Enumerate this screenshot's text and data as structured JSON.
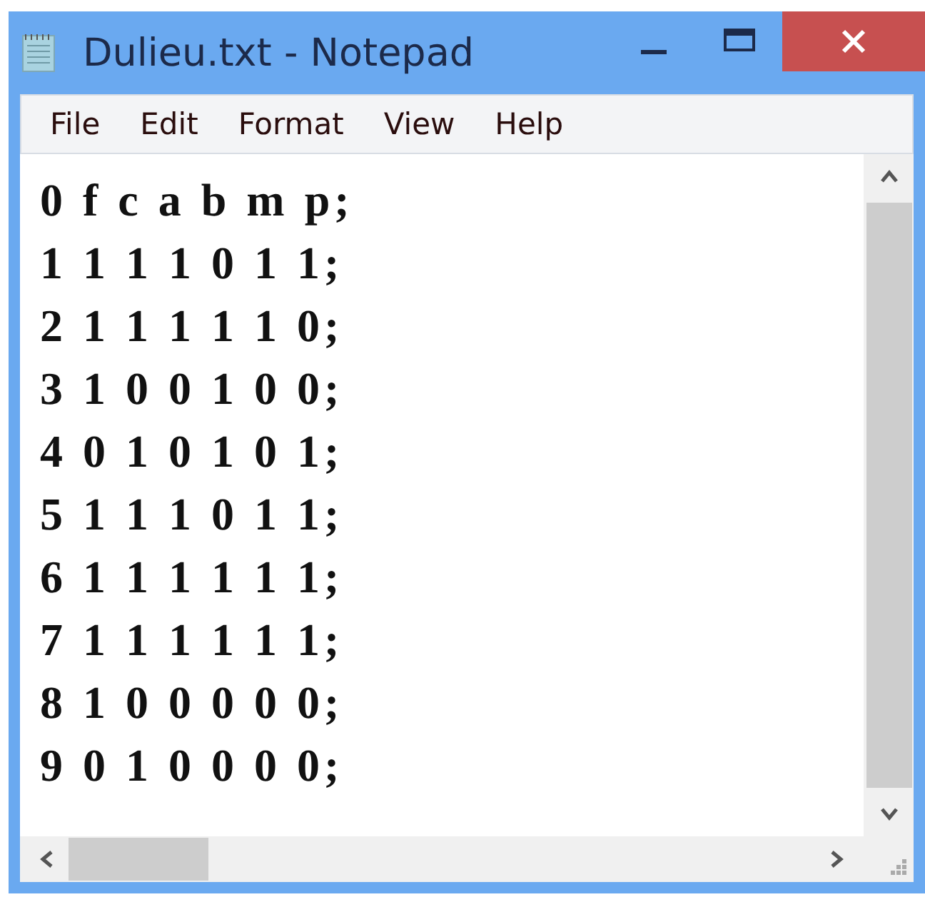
{
  "window": {
    "title": "Dulieu.txt - Notepad"
  },
  "menu": [
    "File",
    "Edit",
    "Format",
    "View",
    "Help"
  ],
  "editor": {
    "lines": [
      "0 f c a b m p;",
      "1 1 1 1 0 1 1;",
      "2 1 1 1 1 1 0;",
      "3 1 0 0 1 0 0;",
      "4 0 1 0 1 0 1;",
      "5 1 1 1 0 1 1;",
      "6 1 1 1 1 1 1;",
      "7 1 1 1 1 1 1;",
      "8 1 0 0 0 0 0;",
      "9 0 1 0 0 0 0;"
    ]
  }
}
